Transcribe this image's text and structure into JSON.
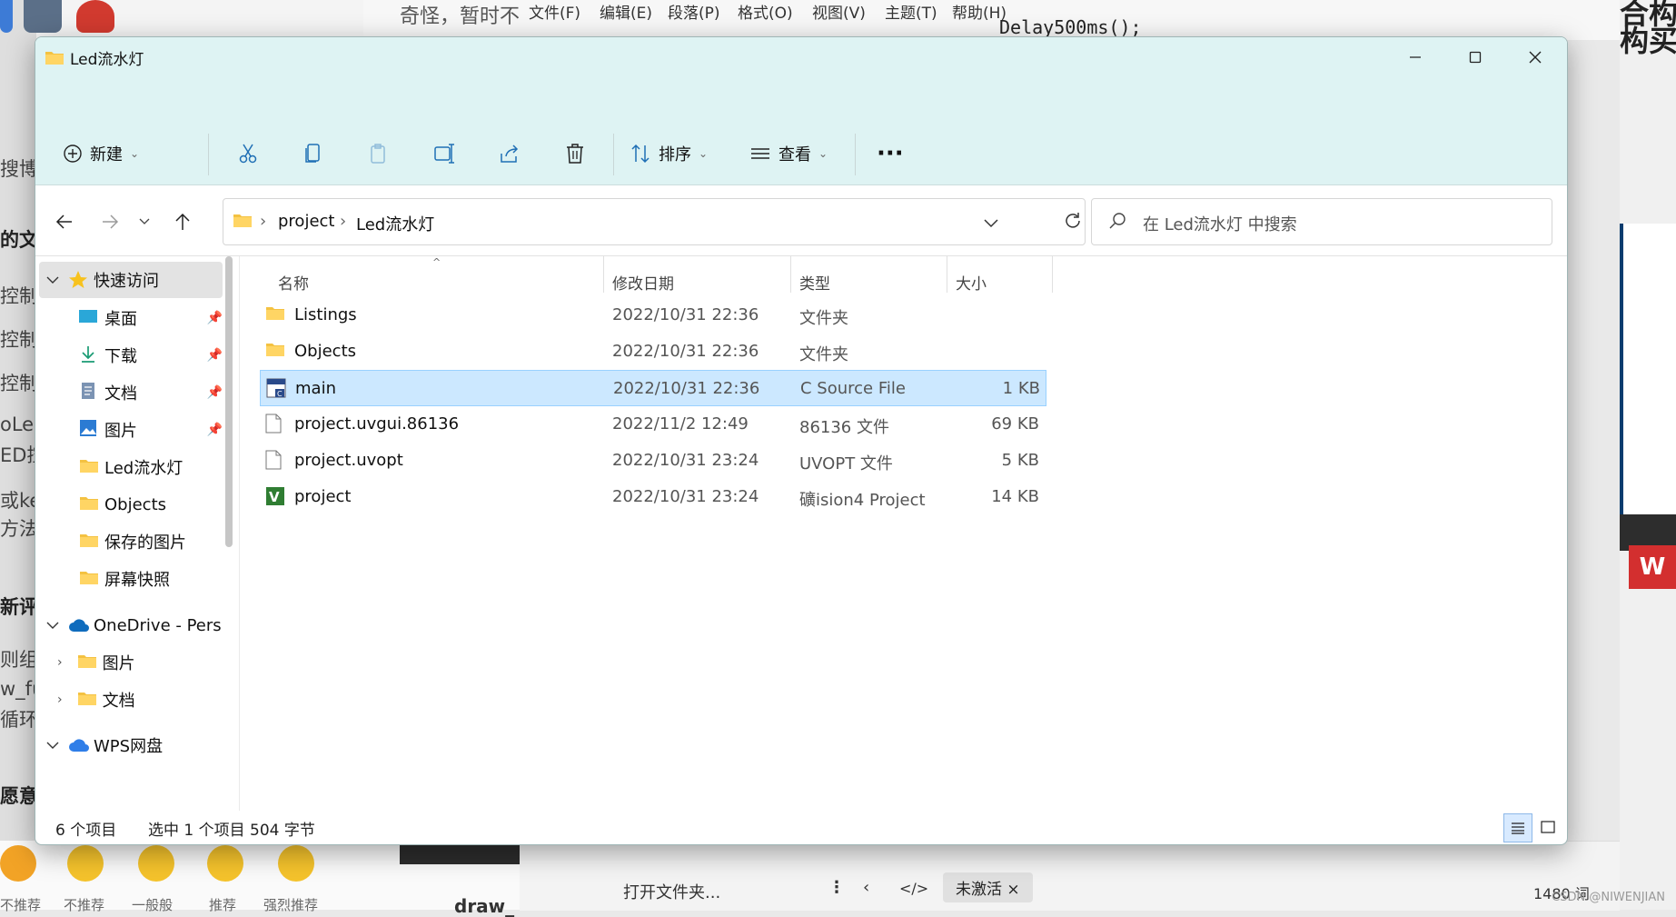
{
  "background": {
    "left_snips": [
      "搜博主",
      "的文章",
      "控制系",
      "控制系",
      "控制系",
      "oLea",
      "ED控",
      "或keil",
      "方法之",
      "新评论",
      "则组工",
      "w_fu",
      "循环删",
      "愿意向"
    ],
    "editor_menu": [
      "奇怪，暂时不",
      "文件(F)",
      "编辑(E)",
      "段落(P)",
      "格式(O)",
      "视图(V)",
      "主题(T)",
      "帮助(H)"
    ],
    "code_line": "Delay500ms();",
    "right_cn": "合构\n构买",
    "emoji_labels": [
      "不推荐",
      "不推荐",
      "一般般",
      "推荐",
      "强烈推荐"
    ],
    "bottom_title": "draw_",
    "open_folder": "打开文件夹...",
    "inactive_pill": "未激活 ×",
    "word_count": "1480 词",
    "watermark": "CSDN @NIWENJIAN",
    "wps_letter": "W"
  },
  "window": {
    "title": "Led流水灯",
    "controls": [
      "minimize",
      "maximize",
      "close"
    ]
  },
  "toolbar": {
    "new_label": "新建",
    "sort_label": "排序",
    "view_label": "查看",
    "more_label": "···",
    "icons": [
      "cut-icon",
      "copy-icon",
      "paste-icon",
      "rename-icon",
      "share-icon",
      "delete-icon"
    ]
  },
  "address": {
    "crumbs": [
      "project",
      "Led流水灯"
    ],
    "search_placeholder": "在 Led流水灯 中搜索"
  },
  "nav": {
    "quick_access": "快速访问",
    "items": [
      {
        "label": "桌面",
        "pinned": true
      },
      {
        "label": "下载",
        "pinned": true
      },
      {
        "label": "文档",
        "pinned": true
      },
      {
        "label": "图片",
        "pinned": true
      },
      {
        "label": "Led流水灯",
        "pinned": false
      },
      {
        "label": "Objects",
        "pinned": false
      },
      {
        "label": "保存的图片",
        "pinned": false
      },
      {
        "label": "屏幕快照",
        "pinned": false
      }
    ],
    "onedrive": "OneDrive - Pers",
    "onedrive_items": [
      "图片",
      "文档"
    ],
    "wps": "WPS网盘"
  },
  "columns": {
    "name": "名称",
    "modified": "修改日期",
    "type": "类型",
    "size": "大小"
  },
  "files": [
    {
      "name": "Listings",
      "date": "2022/10/31 22:36",
      "type": "文件夹",
      "size": "",
      "icon": "folder-icon",
      "selected": false
    },
    {
      "name": "Objects",
      "date": "2022/10/31 22:36",
      "type": "文件夹",
      "size": "",
      "icon": "folder-icon",
      "selected": false
    },
    {
      "name": "main",
      "date": "2022/10/31 22:36",
      "type": "C Source File",
      "size": "1 KB",
      "icon": "c-source-icon",
      "selected": true
    },
    {
      "name": "project.uvgui.86136",
      "date": "2022/11/2 12:49",
      "type": "86136 文件",
      "size": "69 KB",
      "icon": "file-icon",
      "selected": false
    },
    {
      "name": "project.uvopt",
      "date": "2022/10/31 23:24",
      "type": "UVOPT 文件",
      "size": "5 KB",
      "icon": "file-icon",
      "selected": false
    },
    {
      "name": "project",
      "date": "2022/10/31 23:24",
      "type": "礦ision4 Project",
      "size": "14 KB",
      "icon": "uvision-icon",
      "selected": false
    }
  ],
  "status": {
    "count": "6 个项目",
    "selection": "选中 1 个项目  504 字节"
  }
}
